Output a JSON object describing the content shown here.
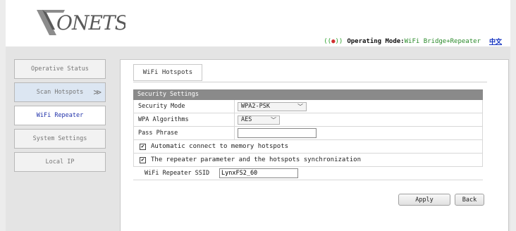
{
  "brand": {
    "logo_text": "VONETS"
  },
  "header": {
    "operating_mode_label": "Operating Mode:",
    "operating_mode_value": "WiFi Bridge+Repeater",
    "language_link": "中文"
  },
  "sidebar": {
    "items": [
      {
        "label": "Operative Status"
      },
      {
        "label": "Scan Hotspots",
        "arrow": ">>"
      },
      {
        "label": "WiFi Repeater"
      },
      {
        "label": "System Settings"
      },
      {
        "label": "Local IP"
      }
    ]
  },
  "main": {
    "tab_label": "WiFi Hotspots",
    "section_title": "Security Settings",
    "security_mode_label": "Security Mode",
    "security_mode_value": "WPA2-PSK",
    "wpa_algorithms_label": "WPA Algorithms",
    "wpa_algorithms_value": "AES",
    "pass_phrase_label": "Pass Phrase",
    "pass_phrase_value": "",
    "auto_connect_label": "Automatic connect to memory hotspots",
    "auto_connect_checked": true,
    "sync_label": "The repeater parameter and the hotspots synchronization",
    "sync_checked": true,
    "ssid_label": "WiFi Repeater SSID",
    "ssid_value": "LynxFS2_60",
    "apply_label": "Apply",
    "back_label": "Back"
  }
}
